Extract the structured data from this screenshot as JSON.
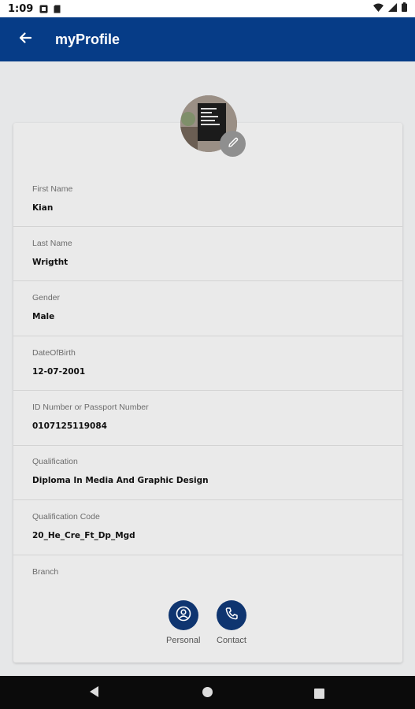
{
  "status_bar": {
    "time": "1:09"
  },
  "app_bar": {
    "title": "myProfile"
  },
  "profile": {
    "fields": [
      {
        "label": "First Name",
        "value": "Kian"
      },
      {
        "label": "Last Name",
        "value": "Wrigtht"
      },
      {
        "label": "Gender",
        "value": "Male"
      },
      {
        "label": "DateOfBirth",
        "value": "12-07-2001"
      },
      {
        "label": "ID Number or Passport Number",
        "value": "0107125119084"
      },
      {
        "label": "Qualification",
        "value": "Diploma In Media And Graphic Design"
      },
      {
        "label": "Qualification Code",
        "value": "20_He_Cre_Ft_Dp_Mgd"
      },
      {
        "label": "Branch",
        "value": ""
      }
    ]
  },
  "actions": {
    "personal_label": "Personal",
    "contact_label": "Contact"
  },
  "colors": {
    "app_bar": "#063c87",
    "action_button": "#0f3570",
    "background": "#e6e7e8"
  },
  "icons": [
    "back-arrow-icon",
    "edit-pencil-icon",
    "person-icon",
    "phone-icon",
    "nav-back-icon",
    "nav-home-icon",
    "nav-recents-icon"
  ]
}
